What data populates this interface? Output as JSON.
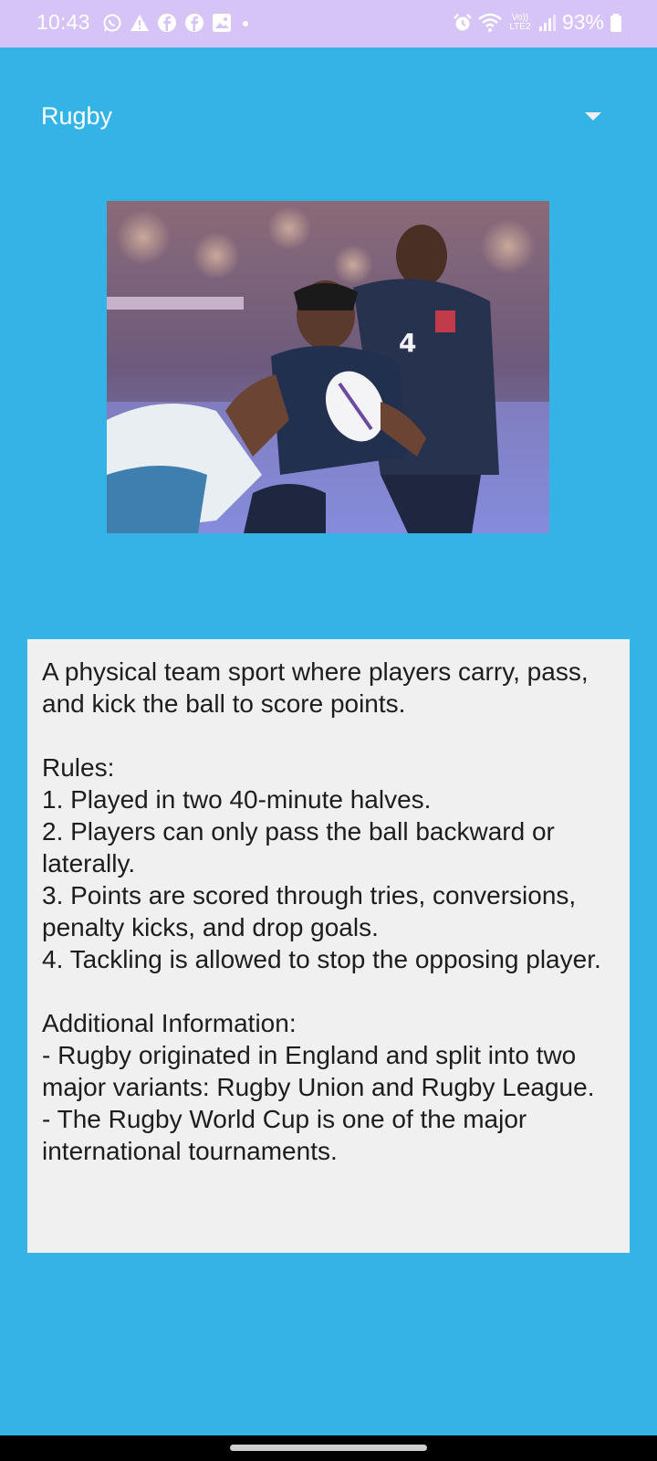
{
  "status_bar": {
    "time": "10:43",
    "network_label": "Vo))\nLTE2",
    "battery": "93%",
    "left_icons": [
      "whatsapp-icon",
      "warning-icon",
      "facebook-icon",
      "facebook-icon",
      "gallery-icon",
      "dot-icon"
    ],
    "right_icons": [
      "alarm-icon",
      "wifi-icon",
      "signal-icon",
      "battery-icon"
    ]
  },
  "dropdown": {
    "selected": "Rugby"
  },
  "image": {
    "subject": "rugby-players-photo"
  },
  "info": {
    "text": "A physical team sport where players carry, pass, and kick the ball to score points.\n\nRules:\n1. Played in two 40-minute halves.\n2. Players can only pass the ball backward or laterally.\n3. Points are scored through tries, conversions, penalty kicks, and drop goals.\n4. Tackling is allowed to stop the opposing player.\n\nAdditional Information:\n- Rugby originated in England and split into two major variants: Rugby Union and Rugby League.\n- The Rugby World Cup is one of the major international tournaments."
  },
  "colors": {
    "background": "#34b4e6",
    "status_bar": "#d7c4f7",
    "card": "#f0f0f0"
  }
}
